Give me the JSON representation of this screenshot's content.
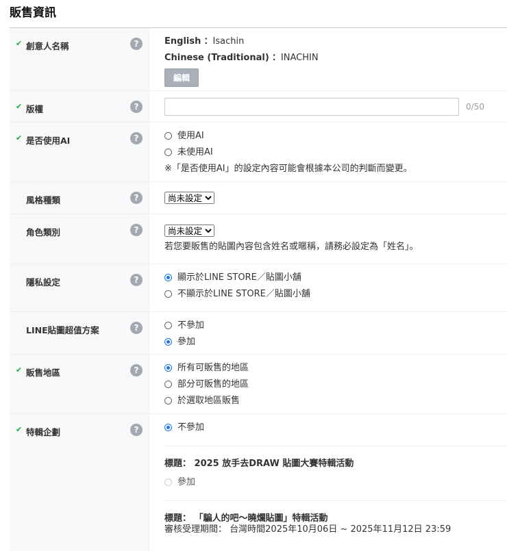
{
  "title": "販售資訊",
  "help": "?",
  "check": "✔",
  "rows": {
    "creator": {
      "label": "創意人名稱",
      "en_label": "English",
      "en_value": "Isachin",
      "zh_label": "Chinese (Traditional)",
      "zh_value": "INACHIN",
      "colon": "：",
      "edit": "編輯"
    },
    "copyright": {
      "label": "版權",
      "value": "",
      "counter": "0/50"
    },
    "ai": {
      "label": "是否使用AI",
      "options": [
        "使用AI",
        "未使用AI"
      ],
      "note": "※「是否使用AI」的設定內容可能會根據本公司的判斷而變更。"
    },
    "style": {
      "label": "風格種類",
      "selected": "尚未設定"
    },
    "character": {
      "label": "角色類別",
      "selected": "尚未設定",
      "note": "若您要販售的貼圖內容包含姓名或暱稱，請務必設定為「姓名」。"
    },
    "privacy": {
      "label": "隱私設定",
      "options": [
        "顯示於LINE STORE／貼圖小舖",
        "不顯示於LINE STORE／貼圖小舖"
      ]
    },
    "premium": {
      "label": "LINE貼圖超值方案",
      "options": [
        "不參加",
        "參加"
      ]
    },
    "region": {
      "label": "販售地區",
      "options": [
        "所有可販售的地區",
        "部分可販售的地區",
        "於選取地區販售"
      ]
    },
    "feature": {
      "label": "特輯企劃",
      "none": "不參加",
      "title_label": "標題：",
      "event1": "2025 放手去DRAW 貼圖大賽特輯活動",
      "join": "參加",
      "event2": "「騙人的吧～曉爛貼圖」特輯活動",
      "period_label": "審核受理期間：",
      "period": "台灣時間2025年10月06日 ~ 2025年11月12日 23:59"
    }
  }
}
